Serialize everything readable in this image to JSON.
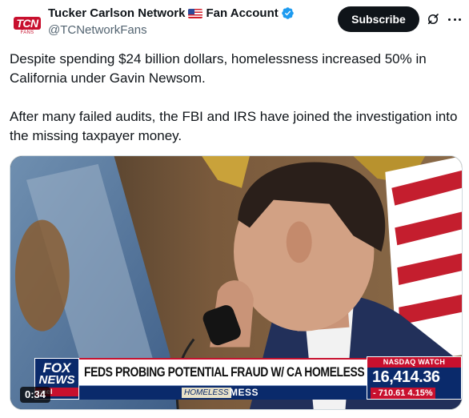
{
  "author": {
    "display_name": "Tucker Carlson Network",
    "display_name_suffix": "Fan Account",
    "handle": "@TCNetworkFans",
    "avatar_text": "TCN",
    "avatar_subtext": "FANS",
    "flag_icon": "us-flag-emoji",
    "verified_icon": "verified-badge-icon",
    "verified_color": "#1d9bf0"
  },
  "actions": {
    "subscribe_label": "Subscribe",
    "grok_icon": "grok-icon",
    "more_icon": "more-horizontal-icon"
  },
  "tweet": {
    "paragraphs": [
      "Despite spending $24 billion dollars, homelessness increased 50% in California under Gavin Newsom.",
      "After many failed audits, the FBI and IRS have joined the investigation into the missing taxpayer money."
    ]
  },
  "video": {
    "timestamp": "0:34",
    "chyron": {
      "network_line1": "FOX",
      "network_line2": "NEWS",
      "network_line3": "nnel",
      "headline": "FEDS PROBING POTENTIAL FRAUD W/ CA HOMELESS FUNDS",
      "sub_tag": "HOMELESS",
      "sub_text": "MESS",
      "ticker_label": "NASDAQ WATCH",
      "ticker_value": "16,414.36",
      "ticker_change": "- 710.61 4.15%"
    }
  },
  "colors": {
    "text_primary": "#0f1419",
    "text_secondary": "#536471",
    "button_bg": "#0f1419",
    "fox_blue": "#0a2a6b",
    "fox_red": "#c8102e"
  }
}
